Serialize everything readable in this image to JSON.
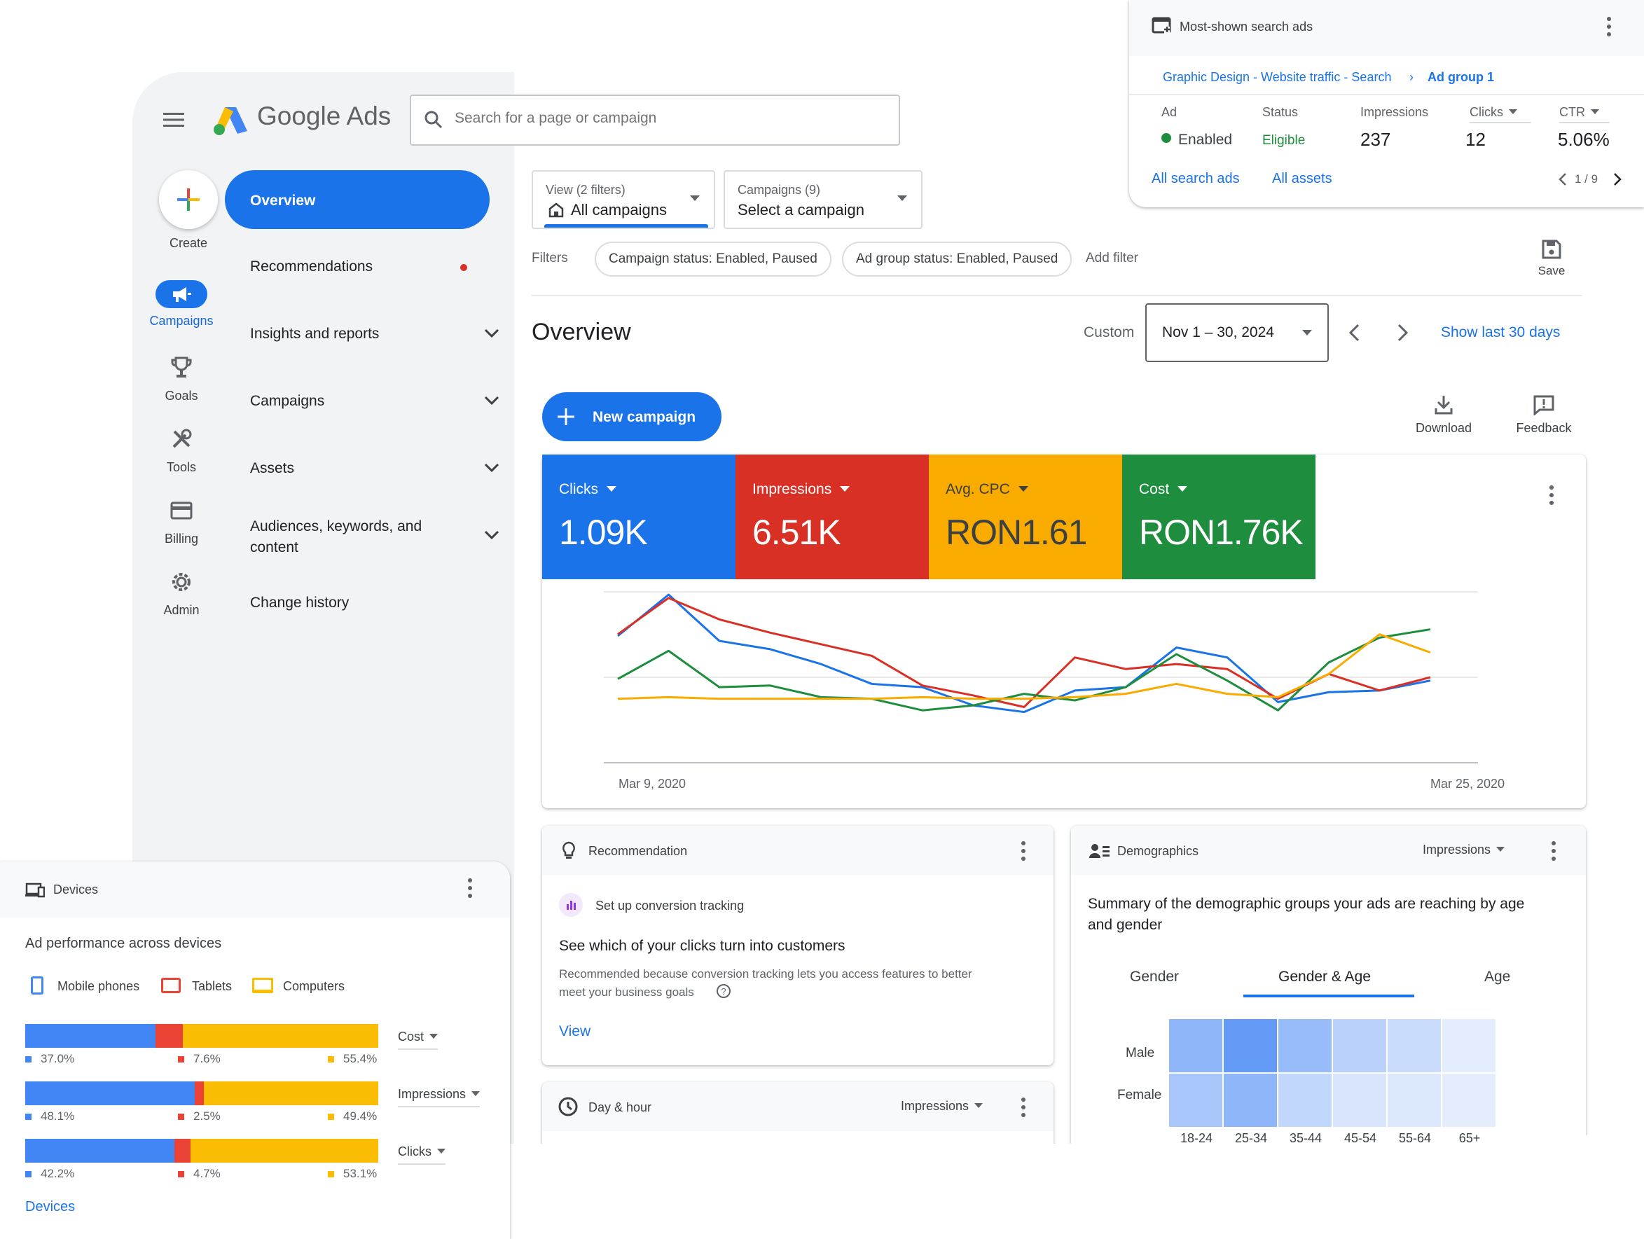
{
  "app": {
    "title": "Google Ads",
    "search_placeholder": "Search for a page or campaign"
  },
  "rail": {
    "create": "Create",
    "campaigns": "Campaigns",
    "goals": "Goals",
    "tools": "Tools",
    "billing": "Billing",
    "admin": "Admin"
  },
  "nav": {
    "overview": "Overview",
    "recommendations": "Recommendations",
    "insights": "Insights and reports",
    "campaigns": "Campaigns",
    "assets": "Assets",
    "audiences_line1": "Audiences, keywords, and",
    "audiences_line2": "content",
    "change_history": "Change history"
  },
  "view_filter": {
    "label": "View (2 filters)",
    "value": "All campaigns"
  },
  "campaign_filter": {
    "label": "Campaigns (9)",
    "value": "Select a campaign"
  },
  "filters": {
    "label": "Filters",
    "chips": [
      "Campaign status: Enabled, Paused",
      "Ad group status: Enabled, Paused"
    ],
    "add": "Add filter",
    "save": "Save"
  },
  "overview": {
    "title": "Overview",
    "date_mode": "Custom",
    "date_range": "Nov 1 – 30, 2024",
    "show_last": "Show last 30 days",
    "new_campaign": "New campaign",
    "download": "Download",
    "feedback": "Feedback"
  },
  "metrics": [
    {
      "label": "Clicks",
      "value": "1.09K",
      "color": "#1a73e8"
    },
    {
      "label": "Impressions",
      "value": "6.51K",
      "color": "#d93025"
    },
    {
      "label": "Avg. CPC",
      "value": "RON1.61",
      "color": "#f9ab00"
    },
    {
      "label": "Cost",
      "value": "RON1.76K",
      "color": "#1e8e3e"
    }
  ],
  "chart_data": {
    "type": "line",
    "x_start_label": "Mar 9, 2020",
    "x_end_label": "Mar 25, 2020",
    "x": [
      "Mar 9, 2020",
      "",
      "",
      "",
      "",
      "",
      "",
      "",
      "",
      "",
      "",
      "",
      "",
      "",
      "",
      "",
      "Mar 25, 2020"
    ],
    "ylim": [
      0,
      100
    ],
    "series": [
      {
        "color": "#1a73e8",
        "values": [
          75,
          100,
          72,
          67,
          58,
          46,
          44,
          33,
          29,
          42,
          44,
          68,
          62,
          35,
          41,
          42,
          48
        ]
      },
      {
        "color": "#d93025",
        "values": [
          76,
          98,
          85,
          77,
          70,
          63,
          45,
          39,
          32,
          62,
          55,
          58,
          55,
          37,
          52,
          42,
          50
        ]
      },
      {
        "color": "#1e8e3e",
        "values": [
          49,
          66,
          44,
          45,
          38,
          37,
          30,
          33,
          40,
          36,
          44,
          64,
          48,
          30,
          59,
          74,
          79
        ]
      },
      {
        "color": "#f9ab00",
        "values": [
          37,
          38,
          37,
          37,
          37,
          37,
          38,
          37,
          37,
          38,
          40,
          46,
          40,
          38,
          52,
          76,
          65
        ]
      }
    ]
  },
  "recommendation": {
    "header": "Recommendation",
    "item": "Set up conversion tracking",
    "title": "See which of your clicks turn into customers",
    "desc_line1": "Recommended because conversion tracking lets you access features to better",
    "desc_line2": "meet your business goals",
    "action": "View"
  },
  "day_hour": {
    "header": "Day & hour",
    "metric": "Impressions"
  },
  "demographics": {
    "header": "Demographics",
    "metric": "Impressions",
    "summary_line1": "Summary of the demographic groups your ads are reaching by age",
    "summary_line2": "and gender",
    "tabs": [
      "Gender",
      "Gender & Age",
      "Age"
    ],
    "active_tab": "Gender & Age",
    "rows": [
      "Male",
      "Female"
    ],
    "cols": [
      "18-24",
      "25-34",
      "35-44",
      "45-54",
      "55-64",
      "65+"
    ],
    "heat": [
      [
        0.55,
        0.8,
        0.5,
        0.3,
        0.2,
        0.05
      ],
      [
        0.4,
        0.55,
        0.25,
        0.12,
        0.1,
        0.05
      ]
    ]
  },
  "search_ads": {
    "header": "Most-shown search ads",
    "crumb1": "Graphic Design - Website traffic - Search",
    "crumb2": "Ad group 1",
    "cols": [
      "Ad",
      "Status",
      "Impressions",
      "Clicks",
      "CTR"
    ],
    "ad_status": "Enabled",
    "status": "Eligible",
    "impressions": "237",
    "clicks": "12",
    "ctr": "5.06%",
    "link1": "All search ads",
    "link2": "All assets",
    "pager": "1 / 9"
  },
  "devices": {
    "header": "Devices",
    "title": "Ad performance across devices",
    "legend": [
      "Mobile phones",
      "Tablets",
      "Computers"
    ],
    "colors": [
      "#4285f4",
      "#ea4335",
      "#fbbc04"
    ],
    "rows": [
      {
        "metric": "Cost",
        "values": [
          37.0,
          7.6,
          55.4
        ],
        "labels": [
          "37.0%",
          "7.6%",
          "55.4%"
        ]
      },
      {
        "metric": "Impressions",
        "values": [
          48.1,
          2.5,
          49.4
        ],
        "labels": [
          "48.1%",
          "2.5%",
          "49.4%"
        ]
      },
      {
        "metric": "Clicks",
        "values": [
          42.2,
          4.7,
          53.1
        ],
        "labels": [
          "42.2%",
          "4.7%",
          "53.1%"
        ]
      }
    ],
    "link": "Devices"
  }
}
